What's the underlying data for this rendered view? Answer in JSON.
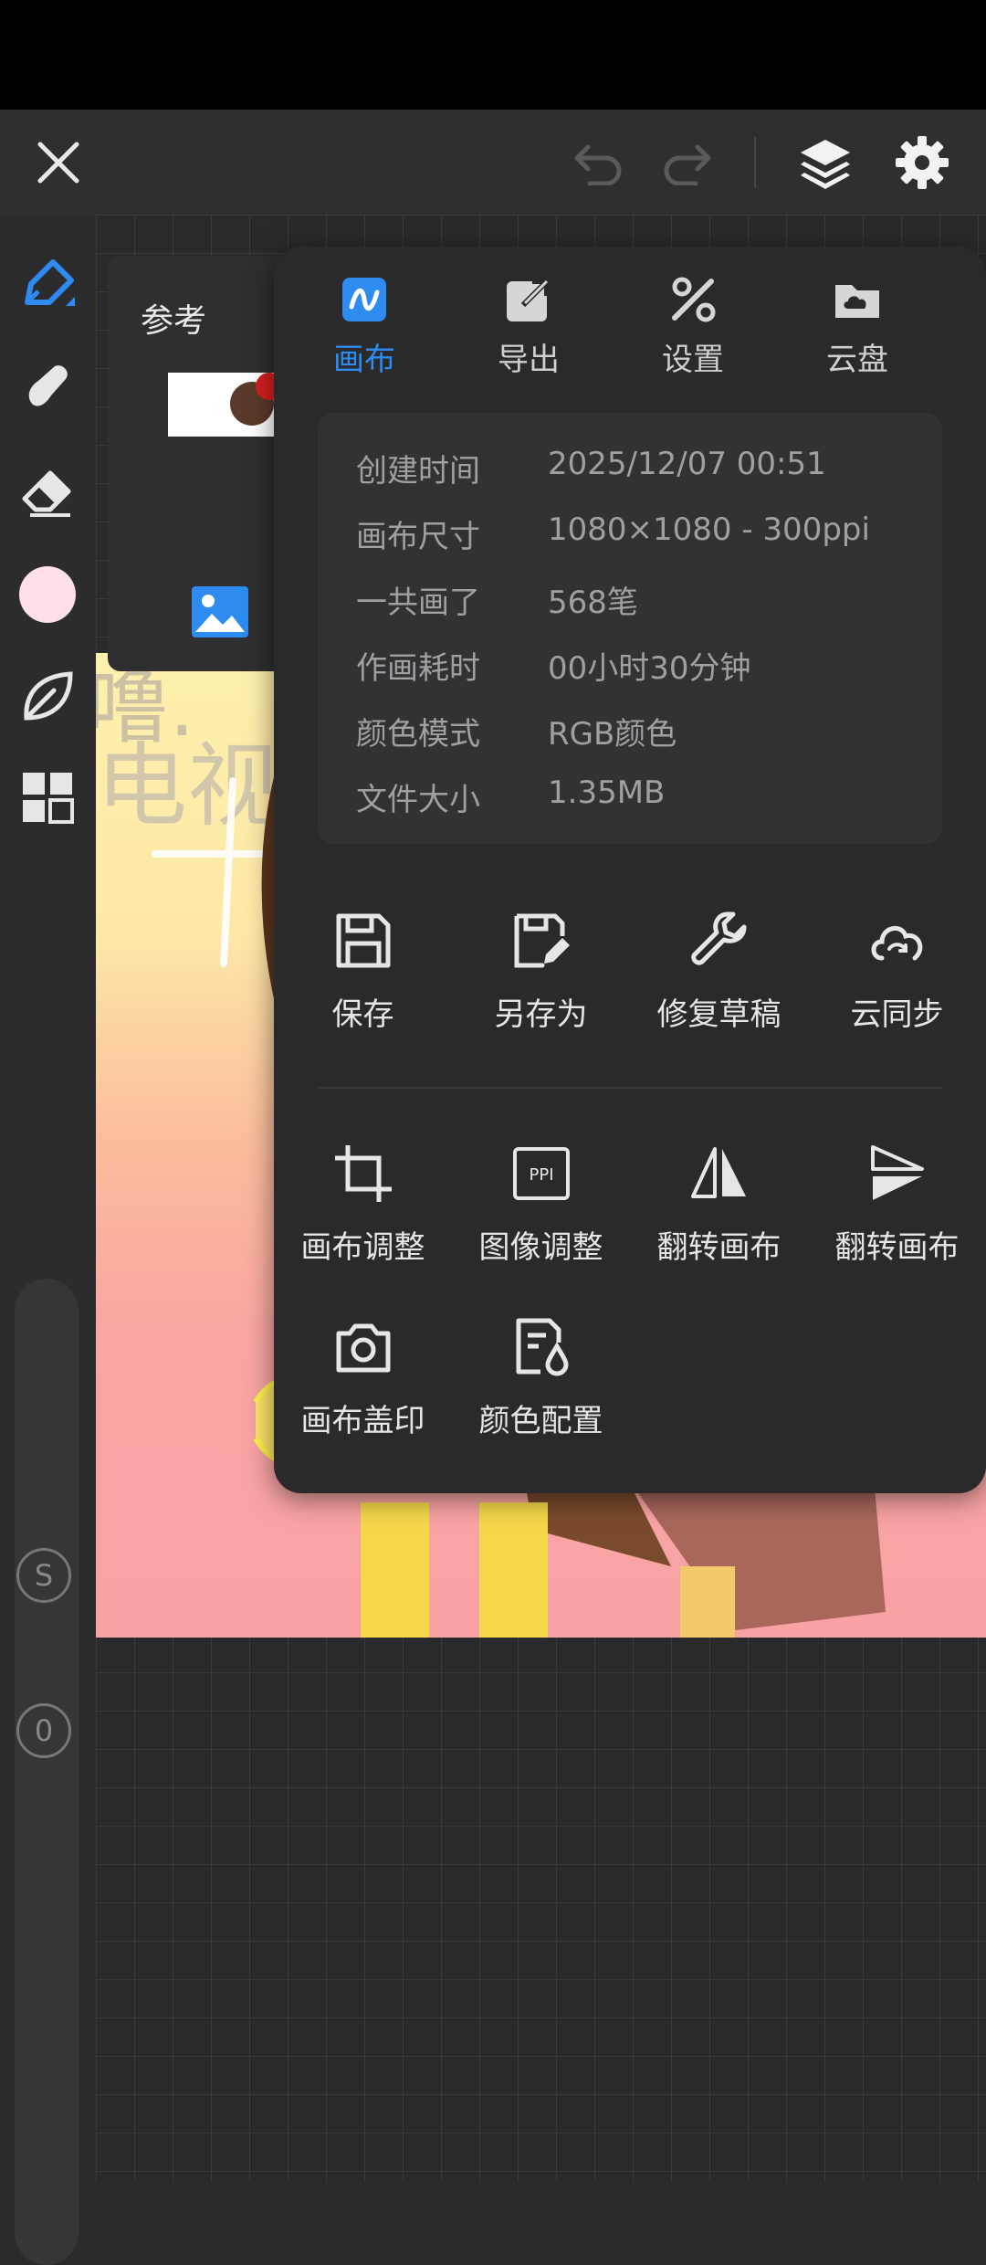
{
  "reference_panel": {
    "title": "参考"
  },
  "menu": {
    "tabs": [
      {
        "label": "画布",
        "icon": "canvas-icon",
        "active": true
      },
      {
        "label": "导出",
        "icon": "export-icon",
        "active": false
      },
      {
        "label": "设置",
        "icon": "tools-icon",
        "active": false
      },
      {
        "label": "云盘",
        "icon": "cloud-drive-icon",
        "active": false
      }
    ],
    "info": [
      {
        "key": "创建时间",
        "value": "2025/12/07 00:51"
      },
      {
        "key": "画布尺寸",
        "value": "1080×1080 - 300ppi"
      },
      {
        "key": "一共画了",
        "value": "568笔"
      },
      {
        "key": "作画耗时",
        "value": "00小时30分钟"
      },
      {
        "key": "颜色模式",
        "value": "RGB颜色"
      },
      {
        "key": "文件大小",
        "value": "1.35MB"
      }
    ],
    "actions": [
      {
        "label": "保存",
        "icon": "save-icon"
      },
      {
        "label": "另存为",
        "icon": "save-as-icon"
      },
      {
        "label": "修复草稿",
        "icon": "wrench-icon"
      },
      {
        "label": "云同步",
        "icon": "cloud-sync-icon"
      },
      {
        "label": "画布调整",
        "icon": "crop-icon"
      },
      {
        "label": "图像调整",
        "icon": "ppi-icon",
        "icon_text": "PPI"
      },
      {
        "label": "翻转画布",
        "icon": "flip-horizontal-icon"
      },
      {
        "label": "翻转画布",
        "icon": "flip-vertical-icon"
      },
      {
        "label": "画布盖印",
        "icon": "camera-icon"
      },
      {
        "label": "颜色配置",
        "icon": "color-profile-icon"
      }
    ]
  },
  "toolbar": {
    "brush_size_label": "S",
    "opacity_label": "0",
    "current_color": "#ffe0ea"
  },
  "colors": {
    "accent": "#2e8bf0",
    "panel": "#2a2a2c"
  }
}
